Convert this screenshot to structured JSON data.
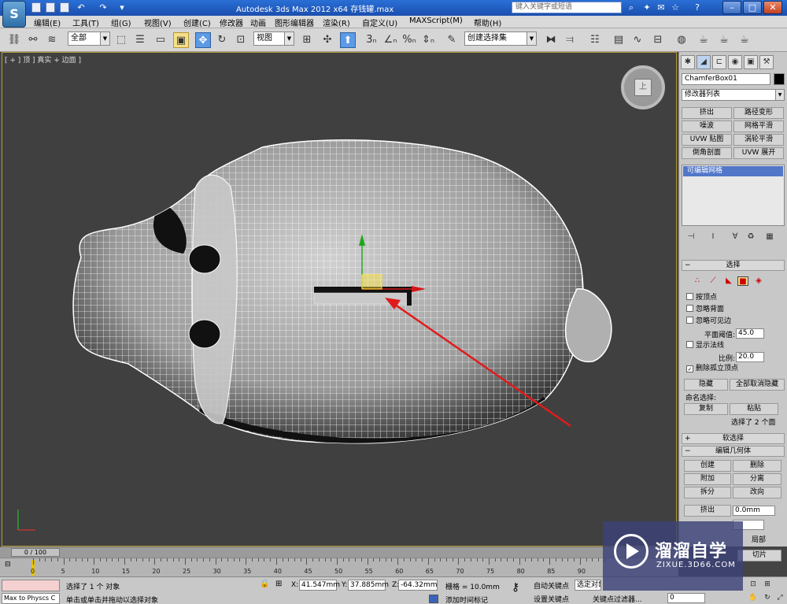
{
  "titlebar": {
    "app_logo": "S",
    "title": "Autodesk 3ds Max  2012 x64     存钱罐.max",
    "search_placeholder": "键入关键字或短语"
  },
  "menu": [
    "编辑(E)",
    "工具(T)",
    "组(G)",
    "视图(V)",
    "创建(C)",
    "修改器",
    "动画",
    "图形编辑器",
    "渲染(R)",
    "自定义(U)",
    "MAXScript(M)",
    "帮助(H)"
  ],
  "toolbar": {
    "selection_filter": "全部",
    "reference_coord": "视图",
    "named_selection": "创建选择集"
  },
  "viewport": {
    "label": "[ + ] 顶 ] 真实 + 边面 ]",
    "viewcube_face": "上"
  },
  "command_panel": {
    "object_name": "ChamferBox01",
    "modifier_list": "修改器列表",
    "modifier_buttons": [
      "挤出",
      "路径变形",
      "噪波",
      "网格平滑",
      "UVW 贴图",
      "涡轮平滑",
      "倒角剖面",
      "UVW 展开"
    ],
    "stack_item": "可编辑网格",
    "selection_rollout": {
      "title": "选择",
      "checks": [
        {
          "label": "按顶点",
          "checked": false
        },
        {
          "label": "忽略背面",
          "checked": false
        },
        {
          "label": "忽略可见边",
          "checked": false
        }
      ],
      "planar_threshold_label": "平面阈值:",
      "planar_threshold": "45.0",
      "show_normals_label": "显示法线",
      "scale_label": "比例:",
      "scale_value": "20.0",
      "delete_isolated_label": "删除孤立顶点",
      "hide_button": "隐藏",
      "unhide_all_button": "全部取消隐藏",
      "named_sel_label": "命名选择:",
      "copy_button": "复制",
      "paste_button": "粘贴",
      "selection_status": "选择了 2 个面"
    },
    "soft_selection": "软选择",
    "edit_geometry": {
      "title": "编辑几何体",
      "buttons": [
        "创建",
        "删除",
        "附加",
        "分离",
        "拆分",
        "改向"
      ],
      "extrude_label": "挤出",
      "extrude_value": "0.0mm",
      "local_label": "局部",
      "slice_label": "切片"
    }
  },
  "timeline": {
    "frame_display": "0 / 100",
    "ticks": [
      "0",
      "5",
      "10",
      "15",
      "20",
      "25",
      "30",
      "35",
      "40",
      "45",
      "50",
      "55",
      "60",
      "65",
      "70",
      "75",
      "80",
      "85",
      "90"
    ]
  },
  "statusbar": {
    "script_text": "Max to Physcs C",
    "status_line1": "选择了 1 个 对象",
    "status_line2": "单击或单击并拖动以选择对象",
    "x_label": "X:",
    "x_value": "41.547mm",
    "y_label": "Y:",
    "y_value": "37.885mm",
    "z_label": "Z:",
    "z_value": "-64.32mm",
    "grid": "栅格 = 10.0mm",
    "auto_key": "自动关键点",
    "set_key": "设置关键点",
    "selected": "选定对象",
    "key_filters": "关键点过滤器...",
    "add_time_tag": "添加时间标记",
    "frame": "0"
  },
  "watermark": {
    "title": "溜溜自学",
    "url": "ZIXUE.3D66.COM"
  }
}
